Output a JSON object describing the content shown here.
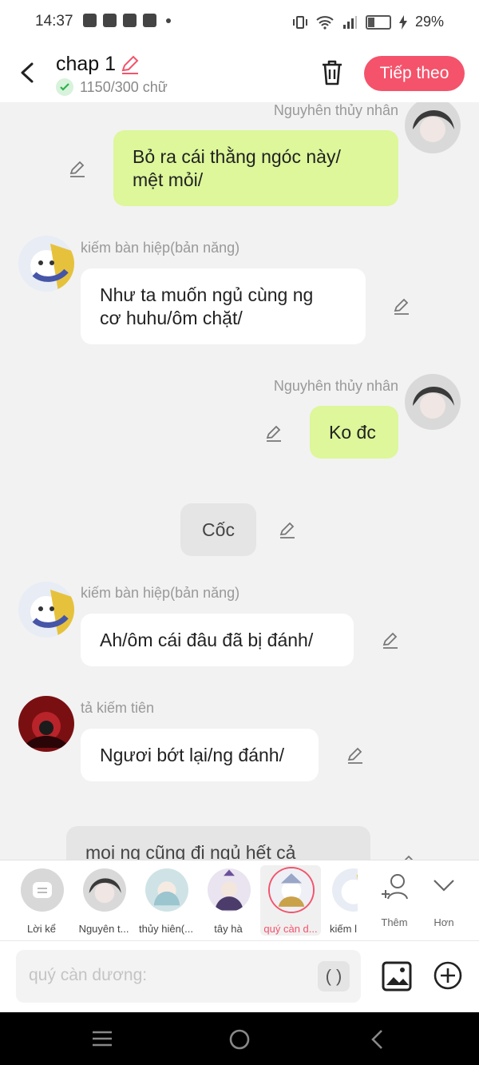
{
  "status_bar": {
    "time": "14:37",
    "battery": "29%",
    "battery_fraction": 0.29
  },
  "header": {
    "title": "chap 1",
    "word_count": "1150/300 chữ",
    "next_label": "Tiếp theo"
  },
  "messages": [
    {
      "speaker": "Nguyhên thủy nhân",
      "text": "Bỏ ra cái thằng ngóc này/\nmệt mỏi/"
    },
    {
      "speaker": "kiếm bàn hiệp(bản năng)",
      "text": "Như ta muốn ngủ cùng ng\ncơ huhu/ôm chặt/"
    },
    {
      "speaker": "Nguyhên thủy nhân",
      "text": "Ko đc"
    },
    {
      "text": "Cốc"
    },
    {
      "speaker": "kiếm bàn hiệp(bản năng)",
      "text": "Ah/ôm cái đâu đã bị đánh/"
    },
    {
      "speaker": "tả kiếm tiên",
      "text": "Ngươi bớt lại/ng đánh/"
    },
    {
      "text": "moi ng cũng đi ngủ hết cả"
    }
  ],
  "characters": {
    "narrator": "Lời kể",
    "c1": "Nguyên t...",
    "c2": "thủy hiên(...",
    "c3": "tây hà",
    "c4": "quý càn d...",
    "c5": "kiếm l",
    "more": "Thêm",
    "expand": "Hơn"
  },
  "composer": {
    "placeholder": "quý càn dương:",
    "paren": "( )"
  }
}
